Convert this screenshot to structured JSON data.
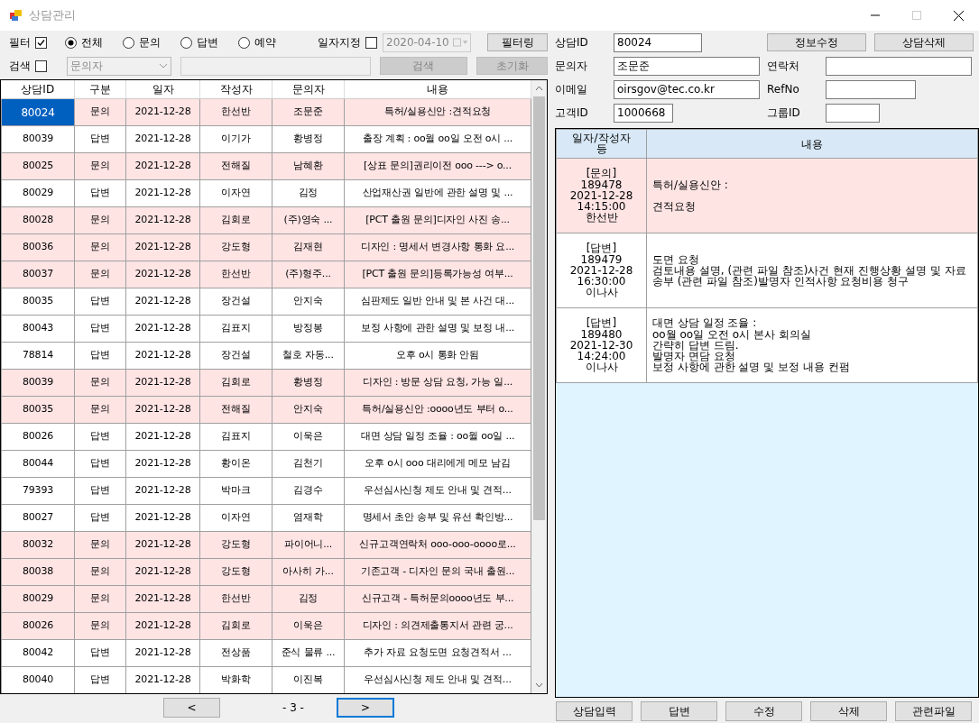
{
  "window": {
    "title": "상담관리"
  },
  "filter": {
    "label": "필터",
    "checked": true,
    "radios": [
      {
        "label": "전체",
        "selected": true
      },
      {
        "label": "문의",
        "selected": false
      },
      {
        "label": "답변",
        "selected": false
      },
      {
        "label": "예약",
        "selected": false
      }
    ],
    "date_label": "일자지정",
    "date_checked": false,
    "date_value": "2020-04-10",
    "button": "필터링"
  },
  "search": {
    "label": "검색",
    "checked": false,
    "combo_value": "문의자",
    "search_button": "검색",
    "reset_button": "초기화"
  },
  "table": {
    "columns": [
      "상담ID",
      "구분",
      "일자",
      "작성자",
      "문의자",
      "내용"
    ],
    "rows": [
      {
        "cells": [
          "80024",
          "문의",
          "2021-12-28",
          "한선반",
          "조문준",
          "특허/실용신안 :견적요청"
        ],
        "kind": "inquiry",
        "selected": true
      },
      {
        "cells": [
          "80039",
          "답변",
          "2021-12-28",
          "이기가",
          "황병정",
          "출장 계획 : oo월 oo일 오전 o시 ..."
        ],
        "kind": "answer",
        "selected": false
      },
      {
        "cells": [
          "80025",
          "문의",
          "2021-12-28",
          "전해질",
          "남혜환",
          "[상표 문의]권리이전  ooo ---> o..."
        ],
        "kind": "inquiry",
        "selected": false
      },
      {
        "cells": [
          "80029",
          "답변",
          "2021-12-28",
          "이자연",
          "김정",
          "산업재산권 일반에 관한 설명 및 ..."
        ],
        "kind": "answer",
        "selected": false
      },
      {
        "cells": [
          "80028",
          "문의",
          "2021-12-28",
          "김회로",
          "(주)영숙 ...",
          "[PCT 출원 문의]디자인 사진 송..."
        ],
        "kind": "inquiry",
        "selected": false
      },
      {
        "cells": [
          "80036",
          "문의",
          "2021-12-28",
          "강도형",
          "김재현",
          "디자인 : 명세서 변경사항 통화 요..."
        ],
        "kind": "inquiry",
        "selected": false
      },
      {
        "cells": [
          "80037",
          "문의",
          "2021-12-28",
          "한선반",
          "(주)형주...",
          "[PCT 출원 문의]등록가능성 여부..."
        ],
        "kind": "inquiry",
        "selected": false
      },
      {
        "cells": [
          "80035",
          "답변",
          "2021-12-28",
          "장건설",
          "안지숙",
          "심판제도 일반 안내 및 본 사건 대..."
        ],
        "kind": "answer",
        "selected": false
      },
      {
        "cells": [
          "80043",
          "답변",
          "2021-12-28",
          "김표지",
          "방정봉",
          "보정 사항에 관한 설명 및 보정 내..."
        ],
        "kind": "answer",
        "selected": false
      },
      {
        "cells": [
          "78814",
          "답변",
          "2021-12-28",
          "장건설",
          "철호 자동...",
          "오후 o시 통화 안됨"
        ],
        "kind": "answer",
        "selected": false
      },
      {
        "cells": [
          "80039",
          "문의",
          "2021-12-28",
          "김회로",
          "황병정",
          "디자인 : 방문 상담 요청, 가능 일..."
        ],
        "kind": "inquiry",
        "selected": false
      },
      {
        "cells": [
          "80035",
          "문의",
          "2021-12-28",
          "전해질",
          "안지숙",
          "특허/실용신안 :oooo년도 부터 o..."
        ],
        "kind": "inquiry",
        "selected": false
      },
      {
        "cells": [
          "80026",
          "답변",
          "2021-12-28",
          "김표지",
          "이욱은",
          "대면 상담 일정 조율 : oo월 oo일 ..."
        ],
        "kind": "answer",
        "selected": false
      },
      {
        "cells": [
          "80044",
          "답변",
          "2021-12-28",
          "황이온",
          "김천기",
          "오후 o시 ooo 대리에게 메모 남김"
        ],
        "kind": "answer",
        "selected": false
      },
      {
        "cells": [
          "79393",
          "답변",
          "2021-12-28",
          "박마크",
          "김경수",
          "우선심사신청 제도 안내 및 견적..."
        ],
        "kind": "answer",
        "selected": false
      },
      {
        "cells": [
          "80027",
          "답변",
          "2021-12-28",
          "이자연",
          "염재학",
          "명세서 초안 송부 및 유선 확인방..."
        ],
        "kind": "answer",
        "selected": false
      },
      {
        "cells": [
          "80032",
          "문의",
          "2021-12-28",
          "강도형",
          "파이어니...",
          "신규고객연락처 ooo-ooo-oooo로..."
        ],
        "kind": "inquiry",
        "selected": false
      },
      {
        "cells": [
          "80038",
          "문의",
          "2021-12-28",
          "강도형",
          "아사히 가...",
          "기존고객 - 디자인 문의 국내 출원..."
        ],
        "kind": "inquiry",
        "selected": false
      },
      {
        "cells": [
          "80029",
          "문의",
          "2021-12-28",
          "한선반",
          "김정",
          "신규고객 - 특허문의oooo년도 부..."
        ],
        "kind": "inquiry",
        "selected": false
      },
      {
        "cells": [
          "80026",
          "문의",
          "2021-12-28",
          "김회로",
          "이욱은",
          "디자인 : 의견제출통지서 관련 궁..."
        ],
        "kind": "inquiry",
        "selected": false
      },
      {
        "cells": [
          "80042",
          "답변",
          "2021-12-28",
          "전상품",
          "준식 물류 ...",
          "추가 자료 요청도면 요청견적서 ..."
        ],
        "kind": "answer",
        "selected": false
      },
      {
        "cells": [
          "80040",
          "답변",
          "2021-12-28",
          "박화학",
          "이진복",
          "우선심사신청 제도 안내 및 견적..."
        ],
        "kind": "answer",
        "selected": false
      }
    ]
  },
  "pager": {
    "prev": "<",
    "page": "- 3 -",
    "next": ">"
  },
  "details": {
    "fields": [
      {
        "label": "상담ID",
        "value": "80024"
      },
      {
        "label": "문의자",
        "value": "조문준"
      },
      {
        "label": "연락처"
      },
      {
        "label": "이메일",
        "value": "oirsgov@tec.co.kr"
      },
      {
        "label": "RefNo"
      },
      {
        "label": "고객ID",
        "value": "1000668"
      },
      {
        "label": "그룹ID"
      }
    ],
    "buttons": [
      "정보수정",
      "상담삭제"
    ]
  },
  "history": {
    "columns": [
      "일자/작성자 등",
      "내용"
    ],
    "entries": [
      {
        "kind": "inquiry",
        "meta": [
          "[문의]",
          "189478",
          "2021-12-28",
          "14:15:00",
          "한선반"
        ],
        "content": [
          "특허/실용신안 :\n\n견적요청"
        ]
      },
      {
        "kind": "answer",
        "meta": [
          "[답변]",
          "189479",
          "2021-12-28",
          "16:30:00",
          "이나사"
        ],
        "content": [
          "도면 요청",
          "검토내용 설명, (관련 파일 참조)사건 현재 진행상황 설명 및 자료 송부 (관련 파일 참조)발명자 인적사항 요청비용 청구"
        ]
      },
      {
        "kind": "answer",
        "meta": [
          "[답변]",
          "189480",
          "2021-12-30",
          "14:24:00",
          "이나사"
        ],
        "content": [
          "대면 상담 일정 조율 :",
          "oo월 oo일 오전 o시 본사 회의실",
          "간략히 답변 드림.",
          "발명자 면담 요청",
          "보정 사항에 관한 설명 및 보정 내용 컨펌"
        ]
      }
    ]
  },
  "actions": [
    "상담입력",
    "답변",
    "수정",
    "삭제",
    "관련파일"
  ]
}
